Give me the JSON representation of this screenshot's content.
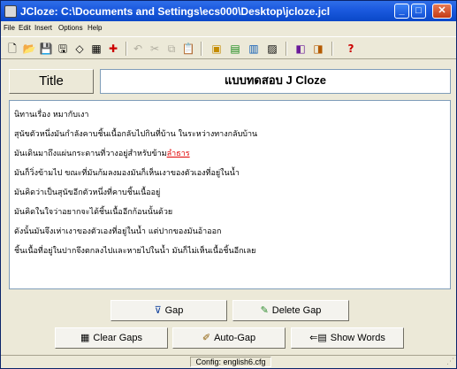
{
  "window": {
    "title": "JCloze: C:\\Documents and Settings\\ecs000\\Desktop\\jcloze.jcl"
  },
  "menu": [
    "File",
    "Edit",
    "Insert",
    "Options",
    "Help"
  ],
  "toolbar": {
    "icons": [
      "new-file-icon",
      "open-folder-icon",
      "save-icon",
      "save-as-icon",
      "clear-icon",
      "find-icon",
      "add-icon",
      "undo-icon",
      "cut-icon",
      "copy-icon",
      "paste-icon",
      "create-web-page-icon",
      "create-html5-icon",
      "export-icon",
      "print-icon",
      "view-icon",
      "config-icon",
      "help-icon"
    ],
    "help_label": "?"
  },
  "title_label": "Title",
  "title_value": "แบบทดสอบ J Cloze",
  "text": {
    "lines": [
      "นิทานเรื่อง หมากับเงา",
      "สุนัขตัวหนึ่งมันกำลังคาบชิ้นเนื้อกลับไปกินที่บ้าน ในระหว่างทางกลับบ้าน",
      "มันเดินมาถึงแผ่นกระดานที่วางอยู่สำหรับข้าม",
      "มันก็วิ่งข้ามไป ขณะที่มันก้มลงมองมันก็เห็นเงาของตัวเองที่อยู่ในน้ำ",
      "มันคิดว่าเป็นสุนัขอีกตัวหนึ่งที่คาบชิ้นเนื้ออยู่",
      "มันคิดในใจว่าอยากจะได้ชิ้นเนื้ออีกก้อนนั้นด้วย",
      "ดังนั้นมันจึงเห่าเงาของตัวเองที่อยู่ในน้ำ แต่ปากของมันอ้าออก",
      "ชิ้นเนื้อที่อยู่ในปากจึงตกลงไปและหายไปในน้ำ มันก็ไม่เห็นเนื้อชิ้นอีกเลย"
    ],
    "gap_word": "ลำธาร"
  },
  "buttons": {
    "gap": "Gap",
    "delete_gap": "Delete Gap",
    "clear_gaps": "Clear Gaps",
    "auto_gap": "Auto-Gap",
    "show_words": "Show Words"
  },
  "status": {
    "config": "Config: english6.cfg"
  },
  "colors": {
    "titlebar": "#0a48c8",
    "gap_word": "#e00000",
    "window_bg": "#ece9d8"
  }
}
